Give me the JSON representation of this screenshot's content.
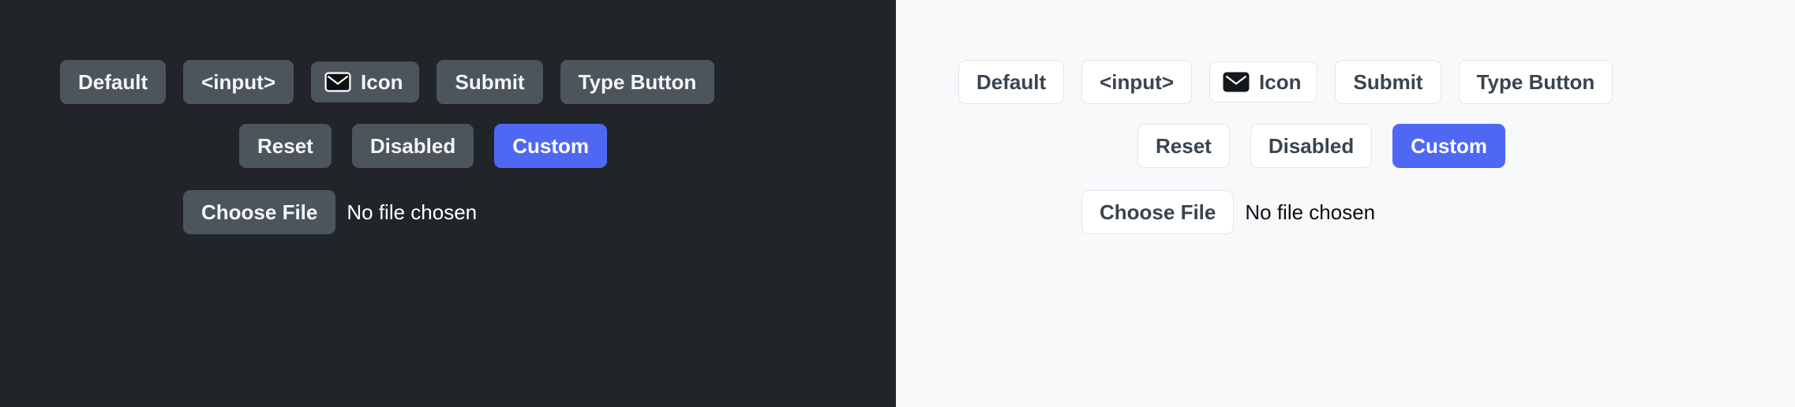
{
  "showcase": {
    "panels": [
      {
        "theme": "dark",
        "background_color": "#212529",
        "button_bg": "#4c545c",
        "button_text": "#f4f5f6",
        "accent_color": "#4f68f4",
        "rows": {
          "row1": [
            {
              "label": "Default",
              "name": "default-button"
            },
            {
              "label": "<input>",
              "name": "input-button"
            },
            {
              "label": "Icon",
              "name": "icon-button",
              "icon": "envelope-icon"
            },
            {
              "label": "Submit",
              "name": "submit-button"
            },
            {
              "label": "Type Button",
              "name": "type-button"
            }
          ],
          "row2": [
            {
              "label": "Reset",
              "name": "reset-button"
            },
            {
              "label": "Disabled",
              "name": "disabled-button"
            },
            {
              "label": "Custom",
              "name": "custom-button"
            }
          ],
          "file": {
            "button_label": "Choose File",
            "status_label": "No file chosen"
          }
        }
      },
      {
        "theme": "light",
        "background_color": "#f8f9fb",
        "button_bg": "#ffffff",
        "button_text": "#3a4450",
        "border_color": "#e1e5ea",
        "accent_color": "#4f68f4",
        "rows": {
          "row1": [
            {
              "label": "Default",
              "name": "default-button"
            },
            {
              "label": "<input>",
              "name": "input-button"
            },
            {
              "label": "Icon",
              "name": "icon-button",
              "icon": "envelope-icon"
            },
            {
              "label": "Submit",
              "name": "submit-button"
            },
            {
              "label": "Type Button",
              "name": "type-button"
            }
          ],
          "row2": [
            {
              "label": "Reset",
              "name": "reset-button"
            },
            {
              "label": "Disabled",
              "name": "disabled-button"
            },
            {
              "label": "Custom",
              "name": "custom-button"
            }
          ],
          "file": {
            "button_label": "Choose File",
            "status_label": "No file chosen"
          }
        }
      }
    ]
  }
}
